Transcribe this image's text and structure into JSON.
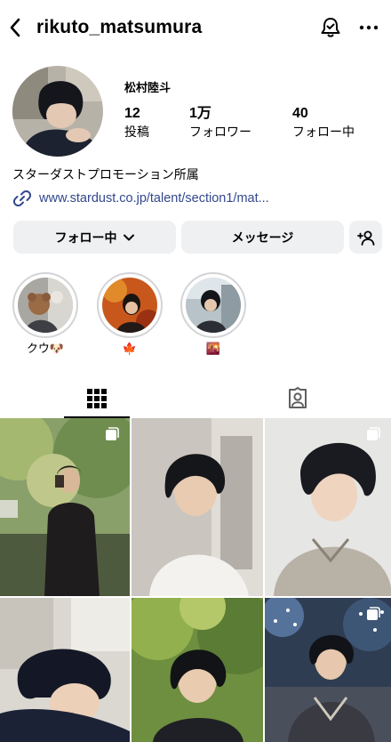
{
  "header": {
    "username": "rikuto_matsumura",
    "icons": {
      "back": "chevron-left-icon",
      "notify": "bell-check-icon",
      "more": "more-horizontal-icon"
    }
  },
  "profile": {
    "display_name": "松村陸斗",
    "stats": [
      {
        "value": "12",
        "label": "投稿"
      },
      {
        "value": "1万",
        "label": "フォロワー"
      },
      {
        "value": "40",
        "label": "フォロー中"
      }
    ],
    "bio": "スターダストプロモーション所属",
    "link": "www.stardust.co.jp/talent/section1/mat..."
  },
  "actions": {
    "follow_label": "フォロー中",
    "message_label": "メッセージ",
    "add_user_icon": "add-user-icon"
  },
  "highlights": [
    {
      "label": "クウ🐶"
    },
    {
      "label": "🍁"
    },
    {
      "label": "🌇"
    }
  ],
  "tabs": {
    "icons": [
      "grid-icon",
      "tagged-icon"
    ],
    "active": 0
  },
  "colors": {
    "link": "#32488e",
    "button_bg": "#eff0f2",
    "ring": "#d3d4d7"
  }
}
